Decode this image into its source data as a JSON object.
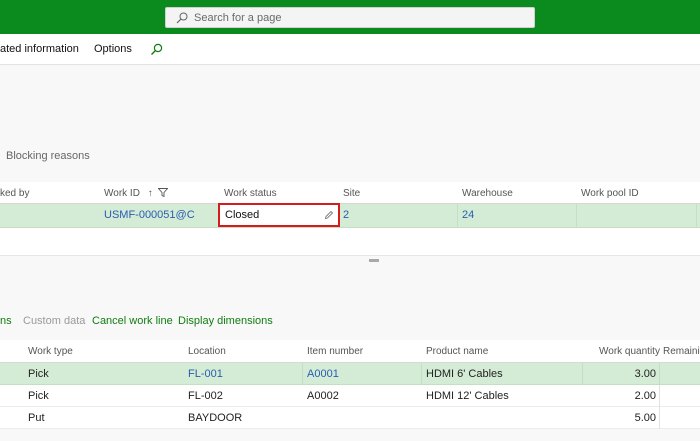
{
  "search": {
    "placeholder": "Search for a page"
  },
  "actionbar": {
    "related_label": "ated information",
    "options_label": "Options"
  },
  "header_tabs": {
    "blocking_reasons": "Blocking reasons"
  },
  "work_grid": {
    "columns": [
      "ked by",
      "Work ID",
      "Work status",
      "Site",
      "Warehouse",
      "Work pool ID"
    ],
    "sort_indicator": "↑",
    "row": {
      "work_id": "USMF-000051@C",
      "work_status": "Closed",
      "site": "2",
      "warehouse": "24",
      "work_pool_id": ""
    }
  },
  "lines_toolbar": {
    "items": [
      "ns",
      "Custom data",
      "Cancel work line",
      "Display dimensions"
    ]
  },
  "lines_grid": {
    "columns": [
      "Work type",
      "Location",
      "Item number",
      "Product name",
      "Work quantity",
      "Remainin"
    ],
    "rows": [
      {
        "work_type": "Pick",
        "location": "FL-001",
        "item_number": "A0001",
        "product_name": "HDMI 6' Cables",
        "work_quantity": "3.00"
      },
      {
        "work_type": "Pick",
        "location": "FL-002",
        "item_number": "A0002",
        "product_name": "HDMI 12' Cables",
        "work_quantity": "2.00"
      },
      {
        "work_type": "Put",
        "location": "BAYDOOR",
        "item_number": "",
        "product_name": "",
        "work_quantity": "5.00"
      }
    ]
  },
  "colors": {
    "brand": "#0b8a1e",
    "selected_row": "#d4ebd6",
    "link": "#2a5db0",
    "highlight": "#d71a1a"
  }
}
